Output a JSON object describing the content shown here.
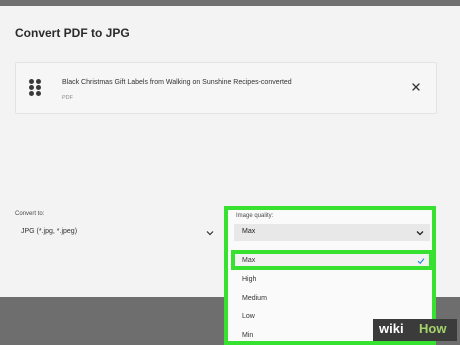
{
  "dialog": {
    "title": "Convert PDF to JPG"
  },
  "file": {
    "name": "Black Christmas Gift Labels from Walking on Sunshine Recipes-converted",
    "type": "PDF",
    "icon": "dots-grid-icon",
    "close_icon": "close-icon"
  },
  "convert": {
    "label": "Convert to:",
    "selected": "JPG (*.jpg, *.jpeg)"
  },
  "quality": {
    "label": "Image quality:",
    "selected": "Max",
    "options": [
      {
        "label": "Max",
        "selected": true
      },
      {
        "label": "High",
        "selected": false
      },
      {
        "label": "Medium",
        "selected": false
      },
      {
        "label": "Low",
        "selected": false
      },
      {
        "label": "Min",
        "selected": false
      }
    ]
  },
  "watermark": {
    "wiki": "wiki",
    "how": "How"
  },
  "colors": {
    "highlight": "#37e130",
    "background": "#f3f3f3",
    "bar": "#6e6e6e"
  }
}
